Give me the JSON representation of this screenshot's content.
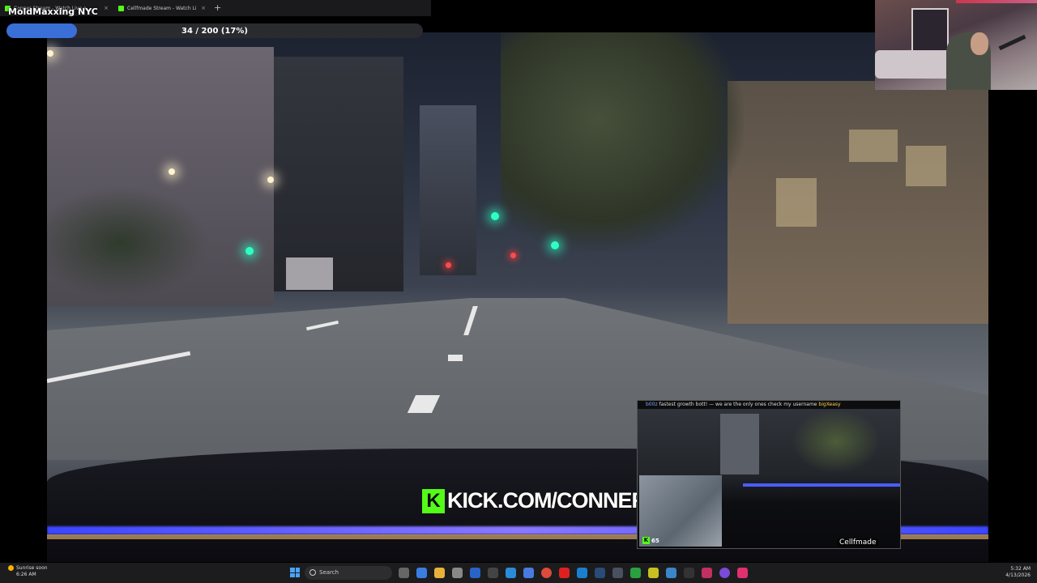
{
  "browser": {
    "tabs": [
      {
        "label": "Conner Stream - Watch Live o"
      },
      {
        "label": "Cellfmade Stream - Watch Li"
      }
    ],
    "new_tab": "+",
    "close_glyph": "×"
  },
  "overlay": {
    "stream_title": "MoldMaxxing NYC",
    "progress": {
      "current": 34,
      "total": 200,
      "percent": 17,
      "label": "34 / 200 (17%)"
    }
  },
  "video": {
    "kick_logo_letter": "K",
    "kick_url": "KICK.COM/CONNER"
  },
  "pip": {
    "chat_user": "b00z",
    "chat_message": "fastest growth bott! — we are the only ones check my username",
    "chat_user2": "bigXeasy",
    "viewer_count": "65",
    "streamer_tag": "Cellfmade"
  },
  "taskbar": {
    "weather_title": "Sunrise soon",
    "weather_time": "6:26 AM",
    "search_placeholder": "Search",
    "clock_time": "5:32 AM",
    "clock_date": "4/13/2026"
  },
  "colors": {
    "kick_green": "#53fc18",
    "progress_fill": "#3a6fd8",
    "dash_glow": "#3c46ff"
  }
}
